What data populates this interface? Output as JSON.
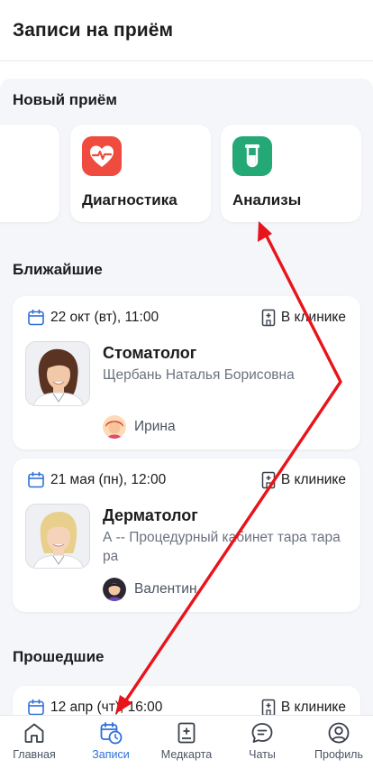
{
  "header": {
    "title": "Записи на приём"
  },
  "new_appointment": {
    "title": "Новый приём",
    "tiles": [
      {
        "label": "Диагностика",
        "icon": "heart-pulse-icon",
        "color": "#f04b3f"
      },
      {
        "label": "Анализы",
        "icon": "test-tube-icon",
        "color": "#24a876"
      }
    ]
  },
  "upcoming": {
    "title": "Ближайшие",
    "cards": [
      {
        "date": "22 окт (вт), 11:00",
        "place": "В клинике",
        "specialty": "Стоматолог",
        "doctor": "Щербань Наталья Борисовна",
        "patient": "Ирина"
      },
      {
        "date": "21 мая (пн), 12:00",
        "place": "В клинике",
        "specialty": "Дерматолог",
        "doctor": "А -- Процедурный кабинет тара тара ра",
        "patient": "Валентин"
      }
    ]
  },
  "past": {
    "title": "Прошедшие",
    "cards": [
      {
        "date": "12 апр (чт), 16:00",
        "place": "В клинике"
      }
    ]
  },
  "bottom_nav": {
    "items": [
      {
        "label": "Главная",
        "icon": "home-icon",
        "active": false
      },
      {
        "label": "Записи",
        "icon": "calendar-clock-icon",
        "active": true
      },
      {
        "label": "Медкарта",
        "icon": "medical-book-icon",
        "active": false
      },
      {
        "label": "Чаты",
        "icon": "chat-icon",
        "active": false
      },
      {
        "label": "Профиль",
        "icon": "profile-icon",
        "active": false
      }
    ]
  },
  "colors": {
    "accent": "#2f6fd9",
    "background": "#f4f6f9",
    "annotation_arrow": "#e8141b"
  }
}
